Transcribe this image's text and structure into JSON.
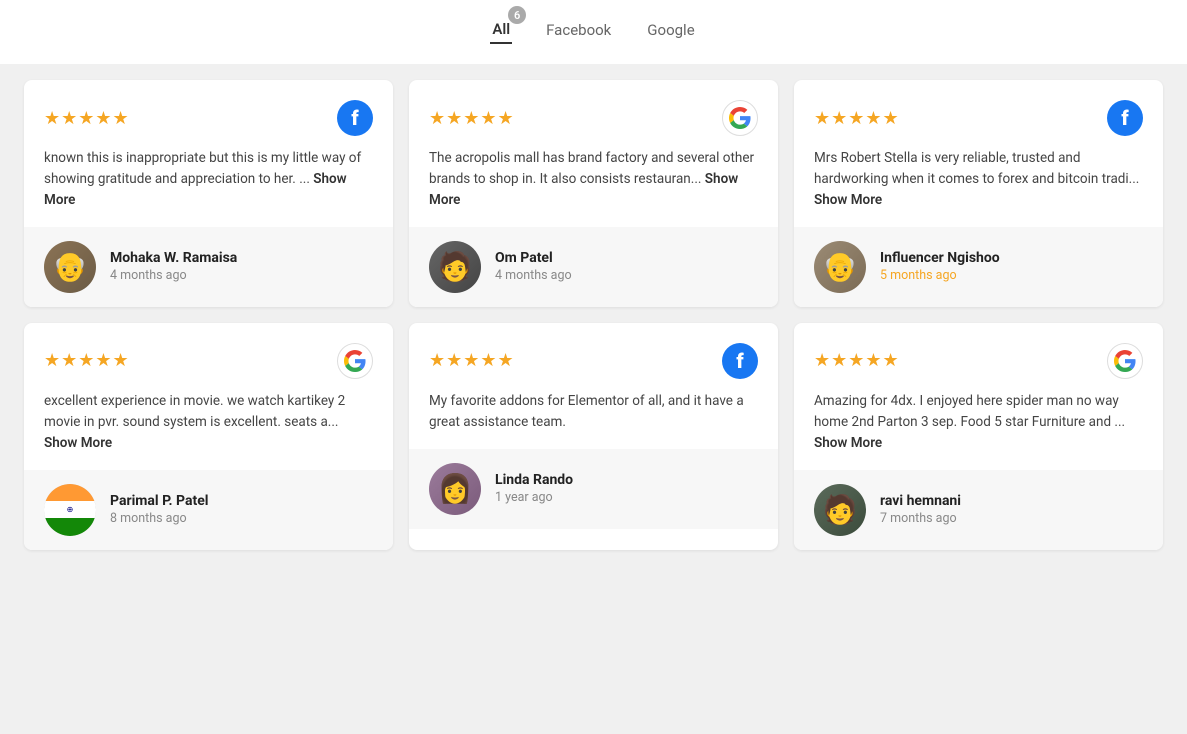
{
  "tabs": [
    {
      "id": "all",
      "label": "All",
      "active": true,
      "badge": "6"
    },
    {
      "id": "facebook",
      "label": "Facebook",
      "active": false,
      "badge": null
    },
    {
      "id": "google",
      "label": "Google",
      "active": false,
      "badge": null
    }
  ],
  "reviews": [
    {
      "id": 1,
      "stars": "★★★★★",
      "platform": "facebook",
      "text": "known this is inappropriate but this is my little way of showing gratitude and appreciation to her. ...",
      "show_more": "Show More",
      "author_name": "Mohaka W. Ramaisa",
      "author_time": "4 months ago",
      "time_highlight": false,
      "avatar_class": "avatar-1",
      "avatar_emoji": "👴"
    },
    {
      "id": 2,
      "stars": "★★★★★",
      "platform": "google",
      "text": "The acropolis mall has brand factory and several other brands to shop in. It also consists restauran...",
      "show_more": "Show More",
      "author_name": "Om Patel",
      "author_time": "4 months ago",
      "time_highlight": false,
      "avatar_class": "avatar-2",
      "avatar_emoji": "🧑"
    },
    {
      "id": 3,
      "stars": "★★★★★",
      "platform": "facebook",
      "text": "Mrs Robert Stella is very reliable, trusted and hardworking when it comes to forex and bitcoin tradi...",
      "show_more": "Show More",
      "author_name": "Influencer Ngishoo",
      "author_time": "5 months ago",
      "time_highlight": true,
      "avatar_class": "avatar-3",
      "avatar_emoji": "👴"
    },
    {
      "id": 4,
      "stars": "★★★★★",
      "platform": "google",
      "text": "excellent experience in movie. we watch kartikey 2 movie in pvr. sound system is excellent. seats a...",
      "show_more": "Show More",
      "author_name": "Parimal P. Patel",
      "author_time": "8 months ago",
      "time_highlight": false,
      "avatar_class": "avatar-4",
      "avatar_emoji": "🇮🇳",
      "is_flag": true
    },
    {
      "id": 5,
      "stars": "★★★★★",
      "platform": "facebook",
      "text": "My favorite addons for Elementor of all, and it have a great assistance team.",
      "show_more": null,
      "author_name": "Linda Rando",
      "author_time": "1 year ago",
      "time_highlight": false,
      "avatar_class": "avatar-5",
      "avatar_emoji": "👩"
    },
    {
      "id": 6,
      "stars": "★★★★★",
      "platform": "google",
      "text": "Amazing for 4dx. I enjoyed here spider man no way home 2nd Parton 3 sep. Food 5 star Furniture and ...",
      "show_more": "Show More",
      "author_name": "ravi hemnani",
      "author_time": "7 months ago",
      "time_highlight": false,
      "avatar_class": "avatar-6",
      "avatar_emoji": "🧑"
    }
  ]
}
